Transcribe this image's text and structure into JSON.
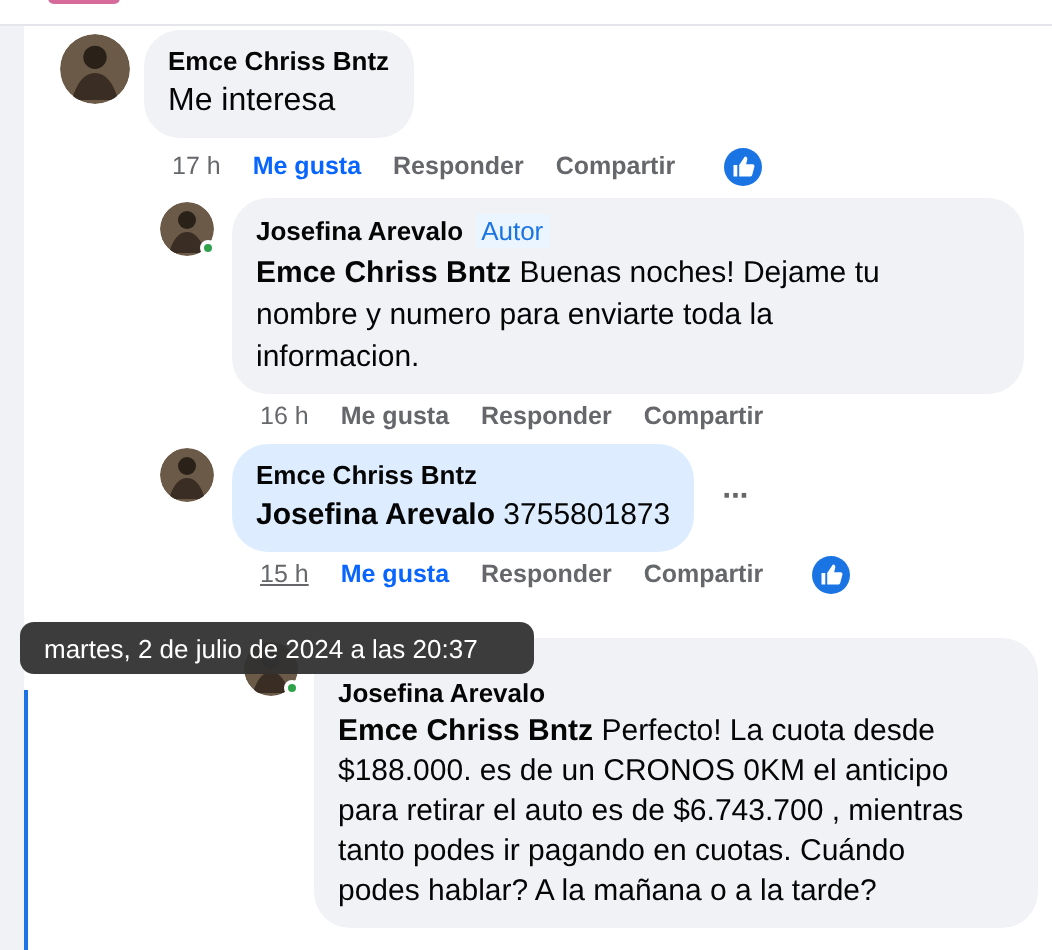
{
  "comments": [
    {
      "author": "Emce Chriss Bntz",
      "online": false,
      "text": "Me interesa",
      "time": "17 h",
      "time_hovered": false,
      "highlighted": false,
      "liked": true,
      "reaction_shown": true,
      "actions": [
        "Me gusta",
        "Responder",
        "Compartir"
      ],
      "children": [
        {
          "author": "Josefina Arevalo",
          "online": true,
          "author_badge": "Autor",
          "mention": "Emce Chriss Bntz",
          "text": "Buenas noches! Dejame tu nombre y numero para enviarte toda la informacion.",
          "time": "16 h",
          "time_hovered": false,
          "highlighted": false,
          "liked": false,
          "reaction_shown": false,
          "actions": [
            "Me gusta",
            "Responder",
            "Compartir"
          ]
        },
        {
          "author": "Emce Chriss Bntz",
          "online": false,
          "mention": "Josefina Arevalo",
          "text": "3755801873",
          "time": "15 h",
          "time_hovered": true,
          "highlighted": true,
          "liked": true,
          "reaction_shown": true,
          "more_label": "···",
          "actions": [
            "Me gusta",
            "Responder",
            "Compartir"
          ],
          "children": [
            {
              "author": "Josefina Arevalo",
              "online": true,
              "highlighted": false,
              "mention": "Emce Chriss Bntz",
              "text": "Perfecto! La cuota desde $188.000. es de un CRONOS 0KM el anticipo para retirar el auto es de $6.743.700 , mientras tanto podes ir pagando en cuotas. Cuándo podes hablar? A la mañana o a la tarde?"
            }
          ]
        }
      ]
    }
  ],
  "tooltip": "martes, 2 de julio de 2024 a las 20:37"
}
